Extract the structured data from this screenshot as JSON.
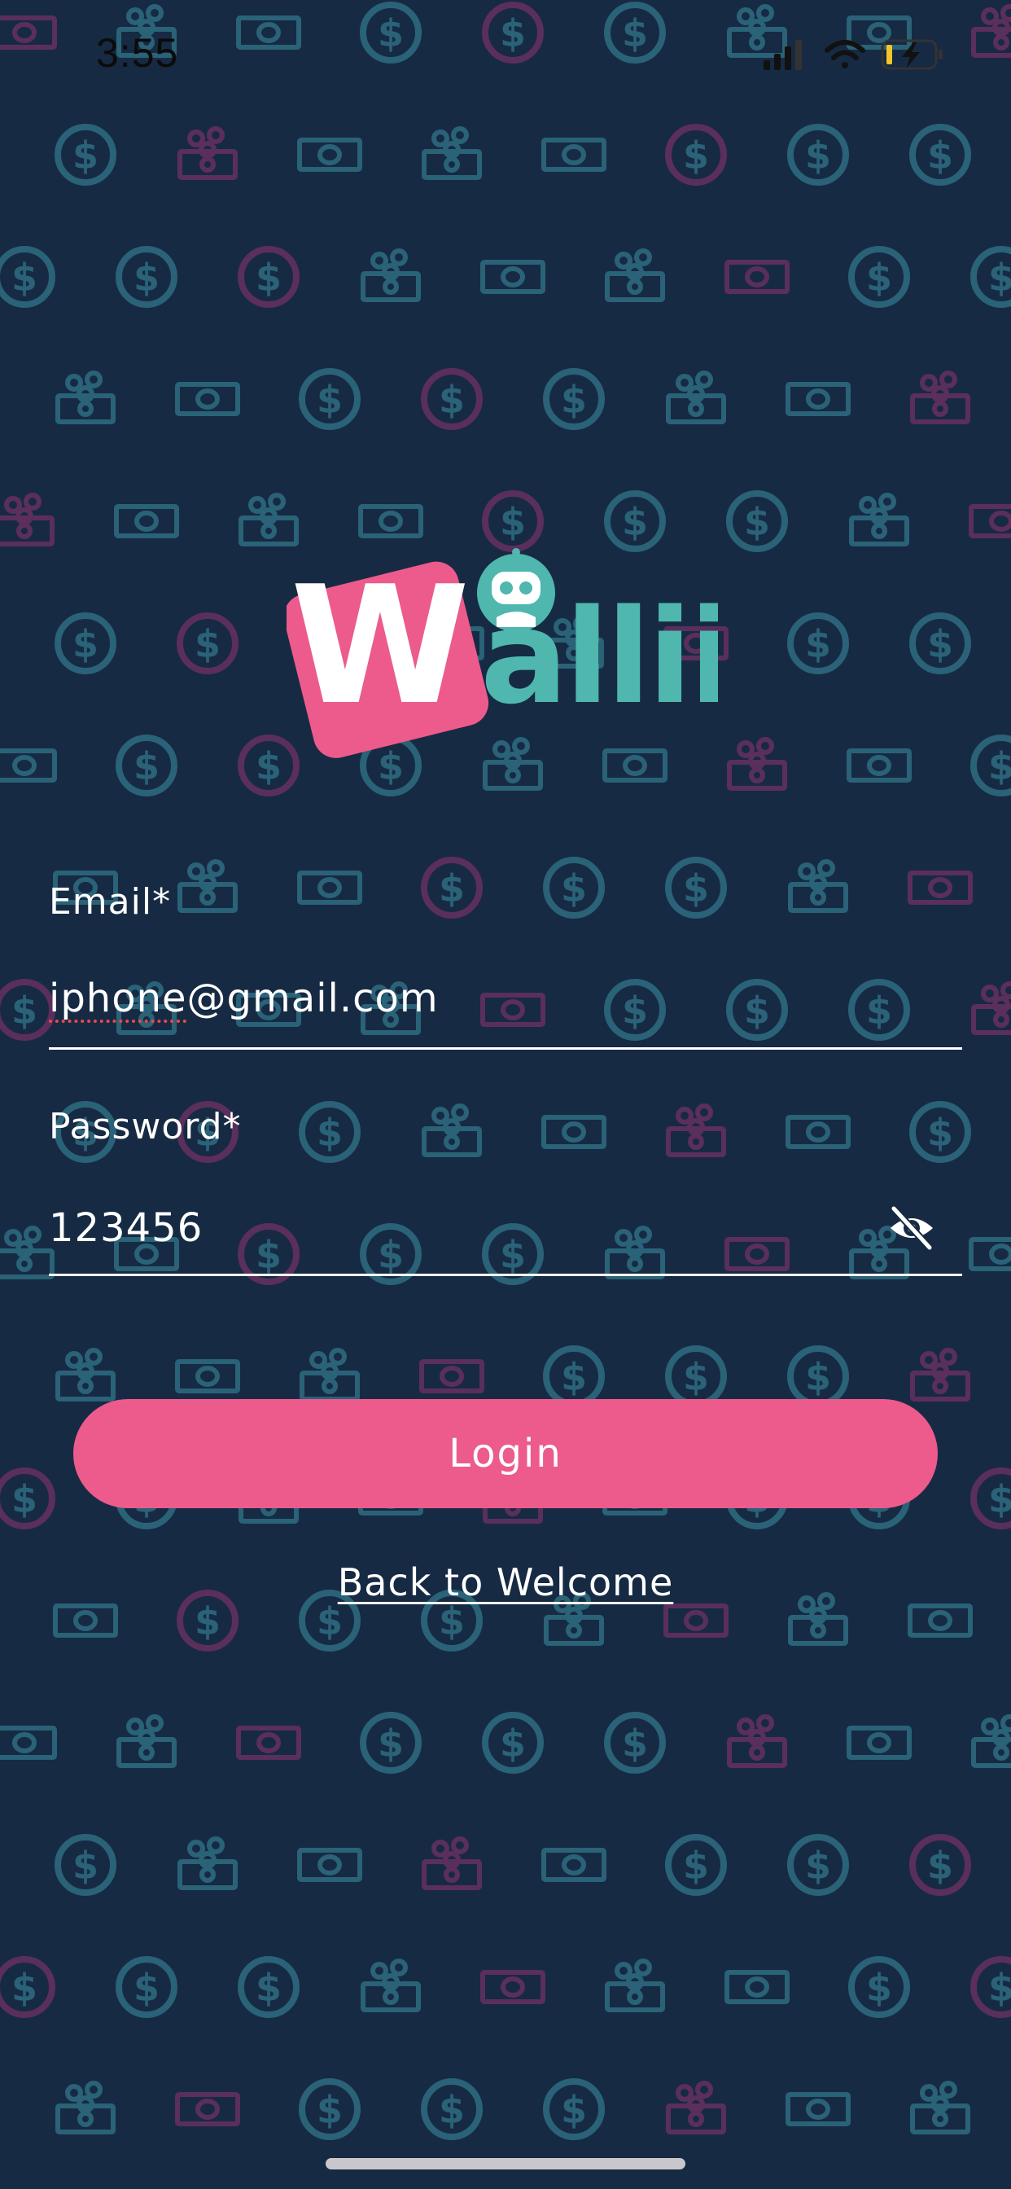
{
  "status_bar": {
    "time": "3:55",
    "icons": [
      "cellular-signal-icon",
      "wifi-icon",
      "battery-charging-icon"
    ]
  },
  "logo": {
    "text_letter": "W",
    "text_rest": "allii",
    "mascot": "robot-icon"
  },
  "form": {
    "email_label": "Email*",
    "email_value": "iphone@gmail.com",
    "email_misspelled_part": "iphone",
    "email_rest": "@gmail.com",
    "password_label": "Password*",
    "password_value": "123456",
    "password_toggle_icon": "eye-slash-icon"
  },
  "actions": {
    "login_label": "Login",
    "back_label": "Back to Welcome"
  },
  "colors": {
    "background": "#172a43",
    "accent_pink": "#ec5b8c",
    "accent_teal": "#4fb7ae",
    "pattern_teal": "#2a6278",
    "pattern_pink": "#5a2f5b"
  }
}
